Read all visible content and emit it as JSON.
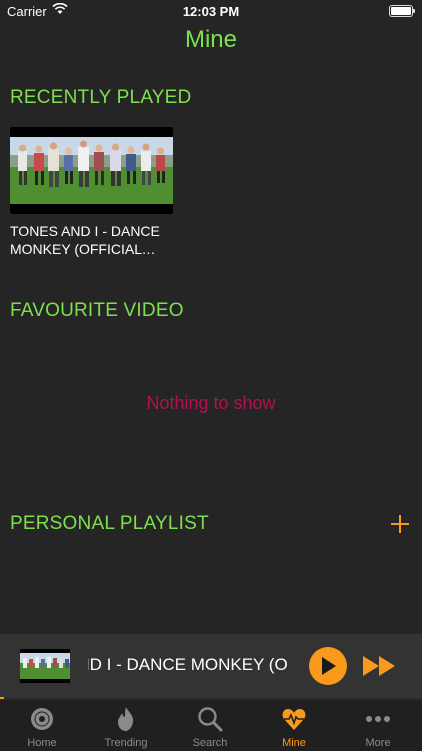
{
  "status_bar": {
    "carrier": "Carrier",
    "time": "12:03 PM"
  },
  "page": {
    "title": "Mine"
  },
  "recently_played": {
    "title": "RECENTLY PLAYED",
    "items": [
      {
        "title": "TONES AND I - DANCE MONKEY (OFFICIAL VIDEO)"
      }
    ]
  },
  "favourite_video": {
    "title": "FAVOURITE VIDEO",
    "empty_text": "Nothing to show"
  },
  "personal_playlist": {
    "title": "PERSONAL PLAYLIST",
    "add_icon": "plus-icon"
  },
  "mini_player": {
    "title": "TONES AND I - DANCE MONKEY (OFFICIAL VIDEO)",
    "play_icon": "play-icon",
    "next_icon": "fast-forward-icon"
  },
  "tabs": [
    {
      "label": "Home",
      "icon": "disc-icon"
    },
    {
      "label": "Trending",
      "icon": "flame-icon"
    },
    {
      "label": "Search",
      "icon": "search-icon"
    },
    {
      "label": "Mine",
      "icon": "heart-pulse-icon",
      "active": true
    },
    {
      "label": "More",
      "icon": "more-icon"
    }
  ],
  "colors": {
    "background": "#252525",
    "section_title": "#7ee04d",
    "accent": "#f99a1c",
    "empty_text": "#b2114f",
    "tab_inactive": "#8a8a8a"
  }
}
